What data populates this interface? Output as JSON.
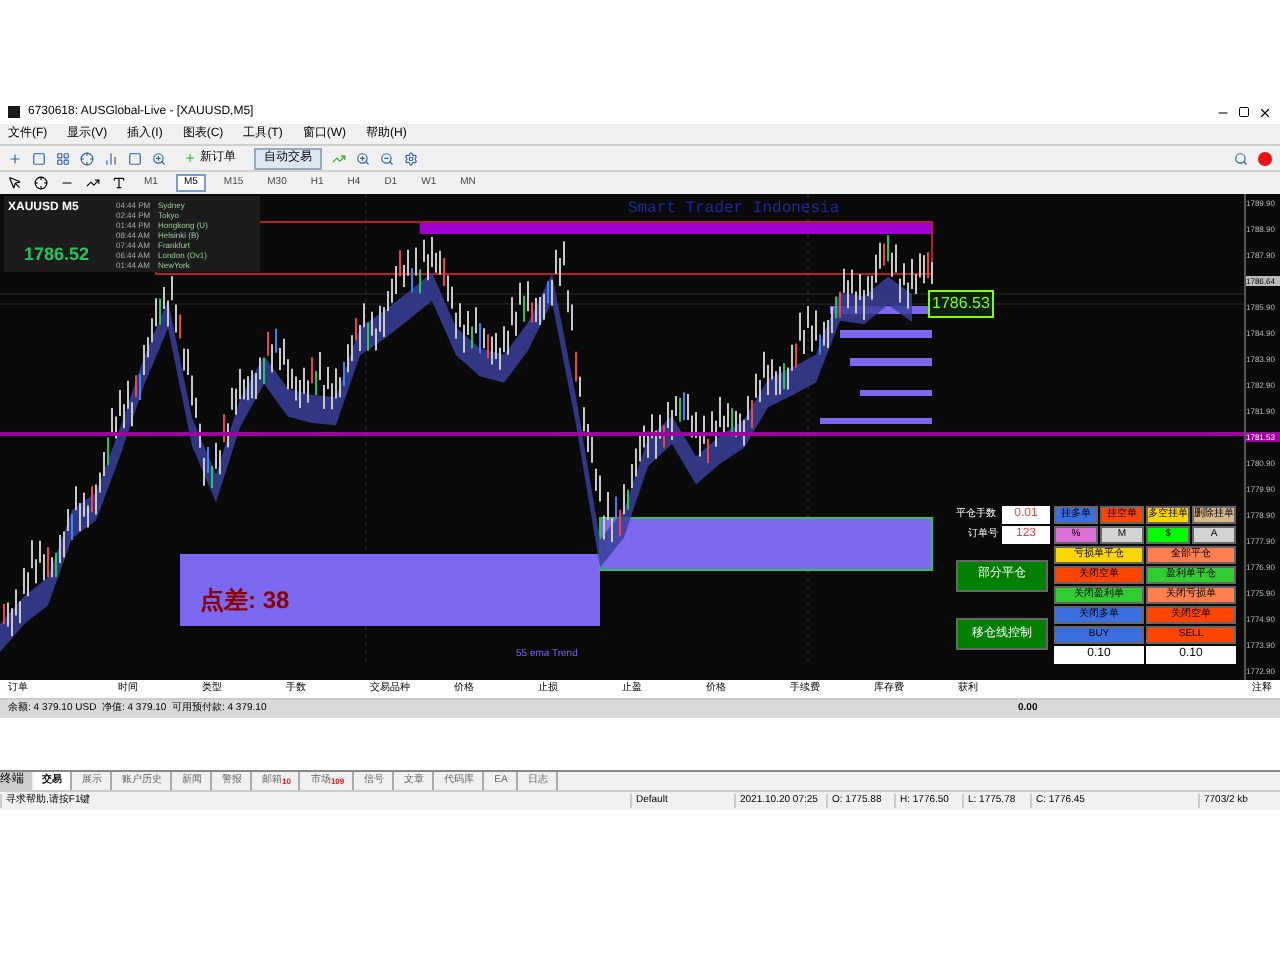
{
  "window": {
    "title": "6730618: AUSGlobal-Live - [XAUUSD,M5]"
  },
  "menu": [
    "文件(F)",
    "显示(V)",
    "插入(I)",
    "图表(C)",
    "工具(T)",
    "窗口(W)",
    "帮助(H)"
  ],
  "toolbar": {
    "new_order": "新订单",
    "auto_trading": "自动交易"
  },
  "timeframes": [
    {
      "label": "M1",
      "selected": false
    },
    {
      "label": "M5",
      "selected": true
    },
    {
      "label": "M15",
      "selected": false
    },
    {
      "label": "M30",
      "selected": false
    },
    {
      "label": "H1",
      "selected": false
    },
    {
      "label": "H4",
      "selected": false
    },
    {
      "label": "D1",
      "selected": false
    },
    {
      "label": "W1",
      "selected": false
    },
    {
      "label": "MN",
      "selected": false
    }
  ],
  "chart": {
    "symbol": "XAUUSD",
    "period": "M5",
    "price": "1786.52",
    "watermark": "Smart Trader Indonesia",
    "price_tag": "1786.53",
    "spread": "点差: 38",
    "trend_label": "55 ema Trend",
    "sessions": [
      {
        "time": "04:44 PM",
        "city": "Sydney"
      },
      {
        "time": "02:44 PM",
        "city": "Tokyo"
      },
      {
        "time": "01:44 PM",
        "city": "Hongkong (U)"
      },
      {
        "time": "08:44 AM",
        "city": "Helsinki (B)"
      },
      {
        "time": "07:44 AM",
        "city": "Frankfurt"
      },
      {
        "time": "06:44 AM",
        "city": "London (Ov1)"
      },
      {
        "time": "01:44 AM",
        "city": "NewYork"
      }
    ],
    "price_axis": [
      {
        "label": "1789.90",
        "kind": "tick"
      },
      {
        "label": "1788.90",
        "kind": "tick"
      },
      {
        "label": "1787.90",
        "kind": "tick"
      },
      {
        "label": "1786.64",
        "kind": "current"
      },
      {
        "label": "1785.90",
        "kind": "tick"
      },
      {
        "label": "1784.90",
        "kind": "tick"
      },
      {
        "label": "1783.90",
        "kind": "tick"
      },
      {
        "label": "1782.90",
        "kind": "tick"
      },
      {
        "label": "1781.90",
        "kind": "tick"
      },
      {
        "label": "1781.53",
        "kind": "line"
      },
      {
        "label": "1780.90",
        "kind": "tick"
      },
      {
        "label": "1779.90",
        "kind": "tick"
      },
      {
        "label": "1778.90",
        "kind": "tick"
      },
      {
        "label": "1777.90",
        "kind": "tick"
      },
      {
        "label": "1776.90",
        "kind": "tick"
      },
      {
        "label": "1775.90",
        "kind": "tick"
      },
      {
        "label": "1774.90",
        "kind": "tick"
      },
      {
        "label": "1773.90",
        "kind": "tick"
      },
      {
        "label": "1772.90",
        "kind": "tick"
      }
    ]
  },
  "order_panel": {
    "lots_label": "平仓手数",
    "lots": "0.01",
    "ticket_label": "订单号",
    "ticket": "123",
    "rows": [
      [
        {
          "label": "挂多单",
          "color": "#3b6fe0"
        },
        {
          "label": "挂空单",
          "color": "#ff4500"
        },
        {
          "label": "多空挂单",
          "color": "#ffd700"
        },
        {
          "label": "删除挂单",
          "color": "#dbb98a"
        }
      ],
      [
        {
          "label": "%",
          "color": "#da70d6"
        },
        {
          "label": "M",
          "color": "#d3d3d3"
        },
        {
          "label": "$",
          "color": "#00ff00"
        },
        {
          "label": "A",
          "color": "#d3d3d3"
        }
      ]
    ],
    "side_buttons": [
      "部分平仓",
      "移仓线控制"
    ],
    "grid": [
      [
        {
          "label": "亏损单平仓",
          "color": "#ffd700"
        },
        {
          "label": "全部平仓",
          "color": "#ff7f50"
        }
      ],
      [
        {
          "label": "关闭空单",
          "color": "#ff4500"
        },
        {
          "label": "盈利单平仓",
          "color": "#32cd32"
        }
      ],
      [
        {
          "label": "关闭盈利单",
          "color": "#32cd32"
        },
        {
          "label": "关闭亏损单",
          "color": "#ff7f50"
        }
      ],
      [
        {
          "label": "关闭多单",
          "color": "#3b6fe0"
        },
        {
          "label": "关闭空单",
          "color": "#ff4500"
        }
      ],
      [
        {
          "label": "BUY",
          "color": "#3b6fe0"
        },
        {
          "label": "SELL",
          "color": "#ff4500"
        }
      ]
    ],
    "buy_lots": "0.10",
    "sell_lots": "0.10"
  },
  "terminal": {
    "columns": [
      "订单",
      "时间",
      "类型",
      "手数",
      "交易品种",
      "价格",
      "止损",
      "止盈",
      "价格",
      "手续费",
      "库存费",
      "获利",
      "注释"
    ],
    "balance": "余额: 4 379.10 USD  净值: 4 379.10  可用预付款: 4 379.10",
    "profit": "0.00",
    "side_label": "终端",
    "tabs": [
      {
        "label": "交易",
        "selected": true
      },
      {
        "label": "展示",
        "selected": false
      },
      {
        "label": "账户历史",
        "selected": false
      },
      {
        "label": "新闻",
        "selected": false
      },
      {
        "label": "警报",
        "selected": false
      },
      {
        "label": "邮箱",
        "count": "10",
        "selected": false
      },
      {
        "label": "市场",
        "count": "109",
        "selected": false
      },
      {
        "label": "信号",
        "selected": false
      },
      {
        "label": "文章",
        "selected": false
      },
      {
        "label": "代码库",
        "selected": false
      },
      {
        "label": "EA",
        "selected": false
      },
      {
        "label": "日志",
        "selected": false
      }
    ]
  },
  "status_bar": [
    "寻求帮助,请按F1键",
    "Default",
    "2021.10.20 07:25",
    "O: 1775.88",
    "H: 1776.50",
    "L: 1775.78",
    "C: 1776.45",
    "7703/2 kb"
  ]
}
